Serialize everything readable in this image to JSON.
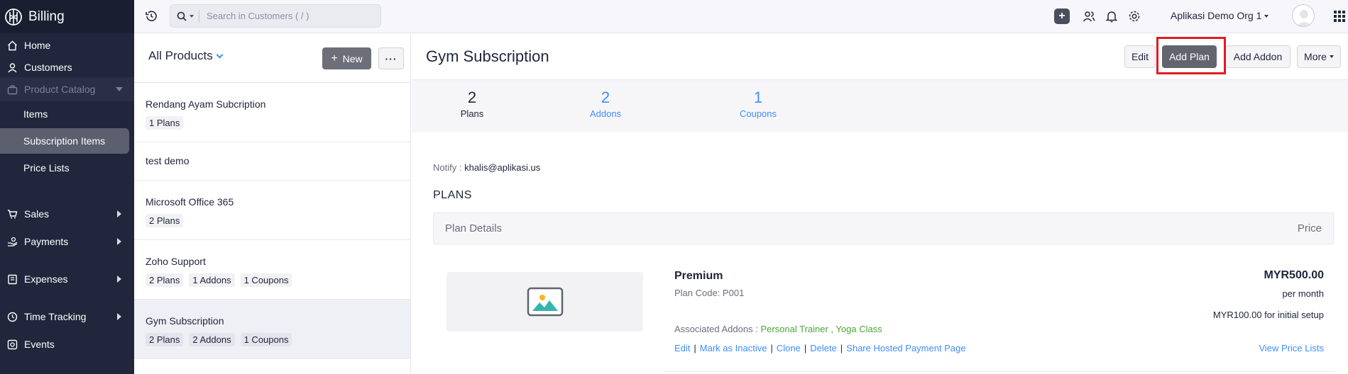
{
  "app": {
    "title": "Billing"
  },
  "sidebar": {
    "items": [
      {
        "label": "Home",
        "icon": "home-icon"
      },
      {
        "label": "Customers",
        "icon": "user-icon"
      },
      {
        "label": "Product Catalog",
        "icon": "bag-icon"
      },
      {
        "label": "Items"
      },
      {
        "label": "Subscription Items"
      },
      {
        "label": "Price Lists"
      },
      {
        "label": "Sales",
        "icon": "cart-icon"
      },
      {
        "label": "Payments",
        "icon": "payment-icon"
      },
      {
        "label": "Expenses",
        "icon": "receipt-icon"
      },
      {
        "label": "Time Tracking",
        "icon": "clock-icon"
      },
      {
        "label": "Events",
        "icon": "events-icon"
      }
    ]
  },
  "topbar": {
    "search_placeholder": "Search in Customers ( / )",
    "org_name": "Aplikasi Demo Org 1"
  },
  "list": {
    "title": "All Products",
    "new_label": "New",
    "items": [
      {
        "name": "Rendang Ayam Subcription",
        "tags": [
          "1 Plans"
        ]
      },
      {
        "name": "test demo",
        "tags": []
      },
      {
        "name": "Microsoft Office 365",
        "tags": [
          "2 Plans"
        ]
      },
      {
        "name": "Zoho Support",
        "tags": [
          "2 Plans",
          "1 Addons",
          "1 Coupons"
        ]
      },
      {
        "name": "Gym Subscription",
        "tags": [
          "2 Plans",
          "2 Addons",
          "1 Coupons"
        ],
        "selected": true
      }
    ]
  },
  "detail": {
    "title": "Gym Subscription",
    "buttons": {
      "edit": "Edit",
      "add_plan": "Add Plan",
      "add_addon": "Add Addon",
      "more": "More"
    },
    "stats": [
      {
        "num": "2",
        "label": "Plans"
      },
      {
        "num": "2",
        "label": "Addons"
      },
      {
        "num": "1",
        "label": "Coupons"
      }
    ],
    "notify_label": "Notify :",
    "notify_email": "khalis@aplikasi.us",
    "plans_heading": "PLANS",
    "table_head": {
      "left": "Plan Details",
      "right": "Price"
    },
    "plan": {
      "name": "Premium",
      "code": "Plan Code: P001",
      "price": "MYR500.00",
      "period": "per month",
      "setup": "MYR100.00 for initial setup",
      "addons_label": "Associated Addons :",
      "addons": "Personal Trainer , Yoga Class",
      "actions": [
        "Edit",
        "Mark as Inactive",
        "Clone",
        "Delete",
        "Share Hosted Payment Page"
      ],
      "view_price_lists": "View Price Lists"
    }
  },
  "colors": {
    "sidebar_bg": "#21263c",
    "accent": "#408dfb",
    "highlight": "#e11b22",
    "addon_green": "#4aa635"
  }
}
